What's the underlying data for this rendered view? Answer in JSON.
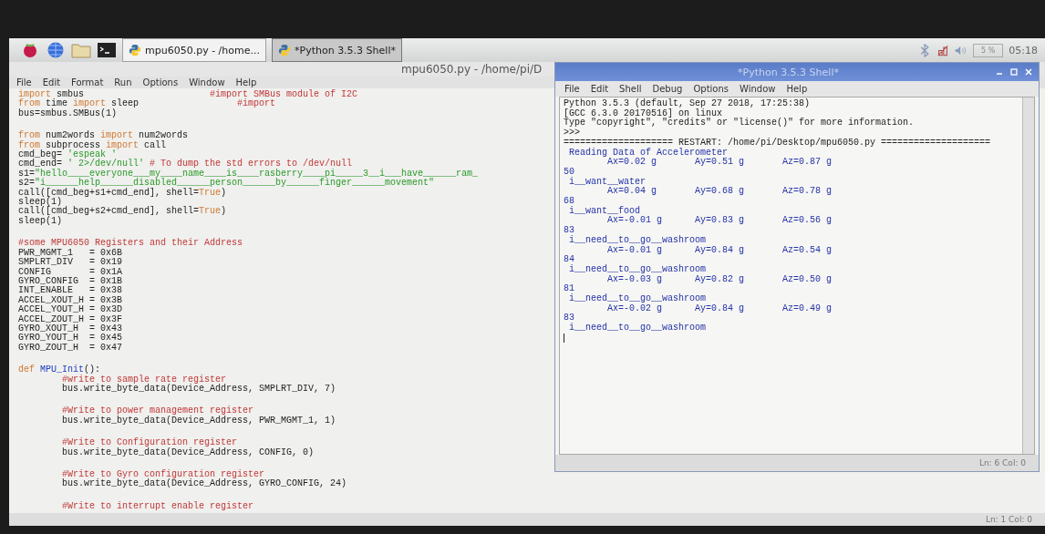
{
  "taskbar": {
    "launchers": [
      {
        "kind": "raspberry"
      },
      {
        "kind": "globe"
      },
      {
        "kind": "folder"
      },
      {
        "kind": "terminal"
      }
    ],
    "tasks": [
      {
        "label": "mpu6050.py - /home...",
        "selected": false
      },
      {
        "label": "*Python 3.5.3 Shell*",
        "selected": true
      }
    ],
    "tray": {
      "cpu": "5 %",
      "clock": "05:18"
    }
  },
  "editor": {
    "title": "mpu6050.py - /home/pi/D",
    "menu": [
      "File",
      "Edit",
      "Format",
      "Run",
      "Options",
      "Window",
      "Help"
    ],
    "blocks": [
      [
        {
          "indented": false,
          "segments": [
            {
              "kind": "keyword",
              "text": "import"
            },
            {
              "kind": "plain",
              "text": " smbus                       "
            },
            {
              "kind": "comment",
              "text": "#import SMBus module of I2C"
            }
          ]
        },
        {
          "indented": false,
          "segments": [
            {
              "kind": "keyword",
              "text": "from"
            },
            {
              "kind": "plain",
              "text": " time "
            },
            {
              "kind": "keyword",
              "text": "import"
            },
            {
              "kind": "plain",
              "text": " sleep                  "
            },
            {
              "kind": "comment",
              "text": "#import"
            }
          ]
        },
        {
          "indented": false,
          "segments": [
            {
              "kind": "plain",
              "text": "bus=smbus.SMBus(1)"
            }
          ]
        }
      ],
      [
        {
          "indented": false,
          "segments": [
            {
              "kind": "keyword",
              "text": "from"
            },
            {
              "kind": "plain",
              "text": " num2words "
            },
            {
              "kind": "keyword",
              "text": "import"
            },
            {
              "kind": "plain",
              "text": " num2words"
            }
          ]
        },
        {
          "indented": false,
          "segments": [
            {
              "kind": "keyword",
              "text": "from"
            },
            {
              "kind": "plain",
              "text": " subprocess "
            },
            {
              "kind": "keyword",
              "text": "import"
            },
            {
              "kind": "plain",
              "text": " call"
            }
          ]
        },
        {
          "indented": false,
          "segments": [
            {
              "kind": "plain",
              "text": "cmd_beg= "
            },
            {
              "kind": "string",
              "text": "'espeak '"
            }
          ]
        },
        {
          "indented": false,
          "segments": [
            {
              "kind": "plain",
              "text": "cmd_end= "
            },
            {
              "kind": "string",
              "text": "' 2>/dev/null'"
            },
            {
              "kind": "comment",
              "text": " # To dump the std errors to /dev/null"
            }
          ]
        },
        {
          "indented": false,
          "segments": [
            {
              "kind": "plain",
              "text": "s1="
            },
            {
              "kind": "string",
              "text": "\"hello____everyone___my____name____is____rasberry____pi_____3__i___have______ram_"
            }
          ]
        },
        {
          "indented": false,
          "segments": [
            {
              "kind": "plain",
              "text": "s2="
            },
            {
              "kind": "string",
              "text": "\"i______help______disabled______person______by______finger______movement\""
            }
          ]
        },
        {
          "indented": false,
          "segments": [
            {
              "kind": "plain",
              "text": "call([cmd_beg+s1+cmd_end], shell="
            },
            {
              "kind": "keyword",
              "text": "True"
            },
            {
              "kind": "plain",
              "text": ")"
            }
          ]
        },
        {
          "indented": false,
          "segments": [
            {
              "kind": "plain",
              "text": "sleep(1)"
            }
          ]
        },
        {
          "indented": false,
          "segments": [
            {
              "kind": "plain",
              "text": "call([cmd_beg+s2+cmd_end], shell="
            },
            {
              "kind": "keyword",
              "text": "True"
            },
            {
              "kind": "plain",
              "text": ")"
            }
          ]
        },
        {
          "indented": false,
          "segments": [
            {
              "kind": "plain",
              "text": "sleep(1)"
            }
          ]
        }
      ],
      [
        {
          "indented": false,
          "segments": [
            {
              "kind": "comment",
              "text": "#some MPU6050 Registers and their Address"
            }
          ]
        },
        {
          "indented": false,
          "segments": [
            {
              "kind": "plain",
              "text": "PWR_MGMT_1   = 0x6B"
            }
          ]
        },
        {
          "indented": false,
          "segments": [
            {
              "kind": "plain",
              "text": "SMPLRT_DIV   = 0x19"
            }
          ]
        },
        {
          "indented": false,
          "segments": [
            {
              "kind": "plain",
              "text": "CONFIG       = 0x1A"
            }
          ]
        },
        {
          "indented": false,
          "segments": [
            {
              "kind": "plain",
              "text": "GYRO_CONFIG  = 0x1B"
            }
          ]
        },
        {
          "indented": false,
          "segments": [
            {
              "kind": "plain",
              "text": "INT_ENABLE   = 0x38"
            }
          ]
        },
        {
          "indented": false,
          "segments": [
            {
              "kind": "plain",
              "text": "ACCEL_XOUT_H = 0x3B"
            }
          ]
        },
        {
          "indented": false,
          "segments": [
            {
              "kind": "plain",
              "text": "ACCEL_YOUT_H = 0x3D"
            }
          ]
        },
        {
          "indented": false,
          "segments": [
            {
              "kind": "plain",
              "text": "ACCEL_ZOUT_H = 0x3F"
            }
          ]
        },
        {
          "indented": false,
          "segments": [
            {
              "kind": "plain",
              "text": "GYRO_XOUT_H  = 0x43"
            }
          ]
        },
        {
          "indented": false,
          "segments": [
            {
              "kind": "plain",
              "text": "GYRO_YOUT_H  = 0x45"
            }
          ]
        },
        {
          "indented": false,
          "segments": [
            {
              "kind": "plain",
              "text": "GYRO_ZOUT_H  = 0x47"
            }
          ]
        }
      ],
      [
        {
          "indented": false,
          "segments": [
            {
              "kind": "keyword",
              "text": "def"
            },
            {
              "kind": "defname",
              "text": "MPU_Init"
            },
            {
              "kind": "plain",
              "text": "():"
            }
          ]
        },
        {
          "indented": true,
          "segments": [
            {
              "kind": "comment",
              "text": "#write to sample rate register"
            }
          ]
        },
        {
          "indented": true,
          "segments": [
            {
              "kind": "plain",
              "text": "bus.write_byte_data(Device_Address, SMPLRT_DIV, 7)"
            }
          ]
        }
      ],
      [
        {
          "indented": true,
          "segments": [
            {
              "kind": "comment",
              "text": "#Write to power management register"
            }
          ]
        },
        {
          "indented": true,
          "segments": [
            {
              "kind": "plain",
              "text": "bus.write_byte_data(Device_Address, PWR_MGMT_1, 1)"
            }
          ]
        }
      ],
      [
        {
          "indented": true,
          "segments": [
            {
              "kind": "comment",
              "text": "#Write to Configuration register"
            }
          ]
        },
        {
          "indented": true,
          "segments": [
            {
              "kind": "plain",
              "text": "bus.write_byte_data(Device_Address, CONFIG, 0)"
            }
          ]
        }
      ],
      [
        {
          "indented": true,
          "segments": [
            {
              "kind": "comment",
              "text": "#Write to Gyro configuration register"
            }
          ]
        },
        {
          "indented": true,
          "segments": [
            {
              "kind": "plain",
              "text": "bus.write_byte_data(Device_Address, GYRO_CONFIG, 24)"
            }
          ]
        }
      ],
      [
        {
          "indented": true,
          "segments": [
            {
              "kind": "comment",
              "text": "#Write to interrupt enable register"
            }
          ]
        }
      ]
    ],
    "status": "Ln: 1  Col: 0"
  },
  "shell": {
    "title": "*Python 3.5.3 Shell*",
    "menu": [
      "File",
      "Edit",
      "Shell",
      "Debug",
      "Options",
      "Window",
      "Help"
    ],
    "lines": [
      {
        "kind": "header",
        "text": "Python 3.5.3 (default, Sep 27 2018, 17:25:38)"
      },
      {
        "kind": "header",
        "text": "[GCC 6.3.0 20170516] on linux"
      },
      {
        "kind": "header",
        "text": "Type \"copyright\", \"credits\" or \"license()\" for more information."
      },
      {
        "kind": "header",
        "text": ">>>"
      },
      {
        "kind": "header",
        "text": "==================== RESTART: /home/pi/Desktop/mpu6050.py ===================="
      },
      {
        "kind": "output",
        "text": " Reading Data of Accelerometer"
      },
      {
        "kind": "output",
        "text": "        Ax=0.02 g       Ay=0.51 g       Az=0.87 g"
      },
      {
        "kind": "output",
        "text": "50"
      },
      {
        "kind": "output",
        "text": " i__want__water"
      },
      {
        "kind": "output",
        "text": "        Ax=0.04 g       Ay=0.68 g       Az=0.78 g"
      },
      {
        "kind": "output",
        "text": "68"
      },
      {
        "kind": "output",
        "text": " i__want__food"
      },
      {
        "kind": "output",
        "text": "        Ax=-0.01 g      Ay=0.83 g       Az=0.56 g"
      },
      {
        "kind": "output",
        "text": "83"
      },
      {
        "kind": "output",
        "text": " i__need__to__go__washroom"
      },
      {
        "kind": "output",
        "text": "        Ax=-0.01 g      Ay=0.84 g       Az=0.54 g"
      },
      {
        "kind": "output",
        "text": "84"
      },
      {
        "kind": "output",
        "text": " i__need__to__go__washroom"
      },
      {
        "kind": "output",
        "text": "        Ax=-0.03 g      Ay=0.82 g       Az=0.50 g"
      },
      {
        "kind": "output",
        "text": "81"
      },
      {
        "kind": "output",
        "text": " i__need__to__go__washroom"
      },
      {
        "kind": "output",
        "text": "        Ax=-0.02 g      Ay=0.84 g       Az=0.49 g"
      },
      {
        "kind": "output",
        "text": "83"
      },
      {
        "kind": "output",
        "text": " i__need__to__go__washroom"
      }
    ],
    "status": "Ln: 6  Col: 0"
  }
}
